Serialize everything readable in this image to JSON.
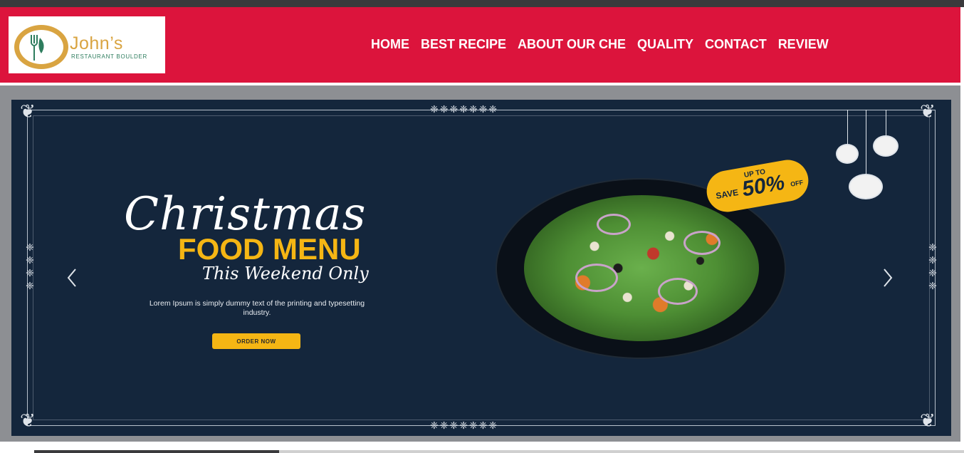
{
  "brand": {
    "name": "John’s",
    "subtitle": "RESTAURANT BOULDER"
  },
  "nav": {
    "items": [
      {
        "label": "HOME"
      },
      {
        "label": "BEST RECIPE"
      },
      {
        "label": "ABOUT OUR CHE"
      },
      {
        "label": "QUALITY"
      },
      {
        "label": "CONTACT"
      },
      {
        "label": "REVIEW"
      }
    ]
  },
  "hero": {
    "script_title": "Christmas",
    "headline": "FOOD MENU",
    "tagline": "This Weekend Only",
    "body": "Lorem Ipsum is simply dummy text of the printing and typesetting industry.",
    "cta_label": "ORDER NOW",
    "badge": {
      "up_to": "UP TO",
      "save": "SAVE",
      "percent": "50%",
      "off": "OFF"
    }
  },
  "colors": {
    "nav_bg": "#dc143c",
    "slide_bg": "#14263c",
    "accent_yellow": "#f5b614",
    "logo_gold": "#d9a441",
    "logo_green": "#2e7d5e"
  },
  "icons": {
    "prev": "chevron-left-icon",
    "next": "chevron-right-icon",
    "logo": "fork-leaf-logo-icon"
  }
}
